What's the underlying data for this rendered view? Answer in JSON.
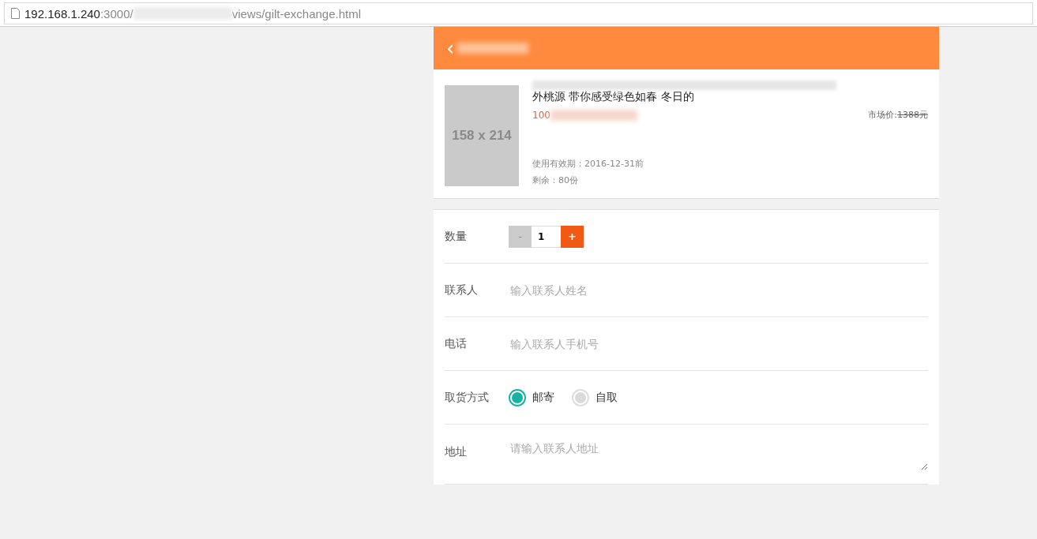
{
  "address_bar": {
    "host": "192.168.1.240",
    "port": ":3000/",
    "path": "views/gilt-exchange.html"
  },
  "header": {
    "back": "‹"
  },
  "product": {
    "image_label": "158 x 214",
    "title": "外桃源 带你感受绿色如春 冬日的",
    "price": "100",
    "market_price_label": "市场价:",
    "market_price": "1388元",
    "validity": "使用有效期：2016-12-31前",
    "remaining": "剩余：80份"
  },
  "form": {
    "quantity": {
      "label": "数量",
      "minus": "-",
      "value": "1",
      "plus": "+"
    },
    "contact": {
      "label": "联系人",
      "placeholder": "输入联系人姓名"
    },
    "phone": {
      "label": "电话",
      "placeholder": "输入联系人手机号"
    },
    "delivery": {
      "label": "取货方式",
      "options": [
        {
          "label": "邮寄",
          "selected": true
        },
        {
          "label": "自取",
          "selected": false
        }
      ]
    },
    "address": {
      "label": "地址",
      "placeholder": "请输入联系人地址"
    }
  }
}
